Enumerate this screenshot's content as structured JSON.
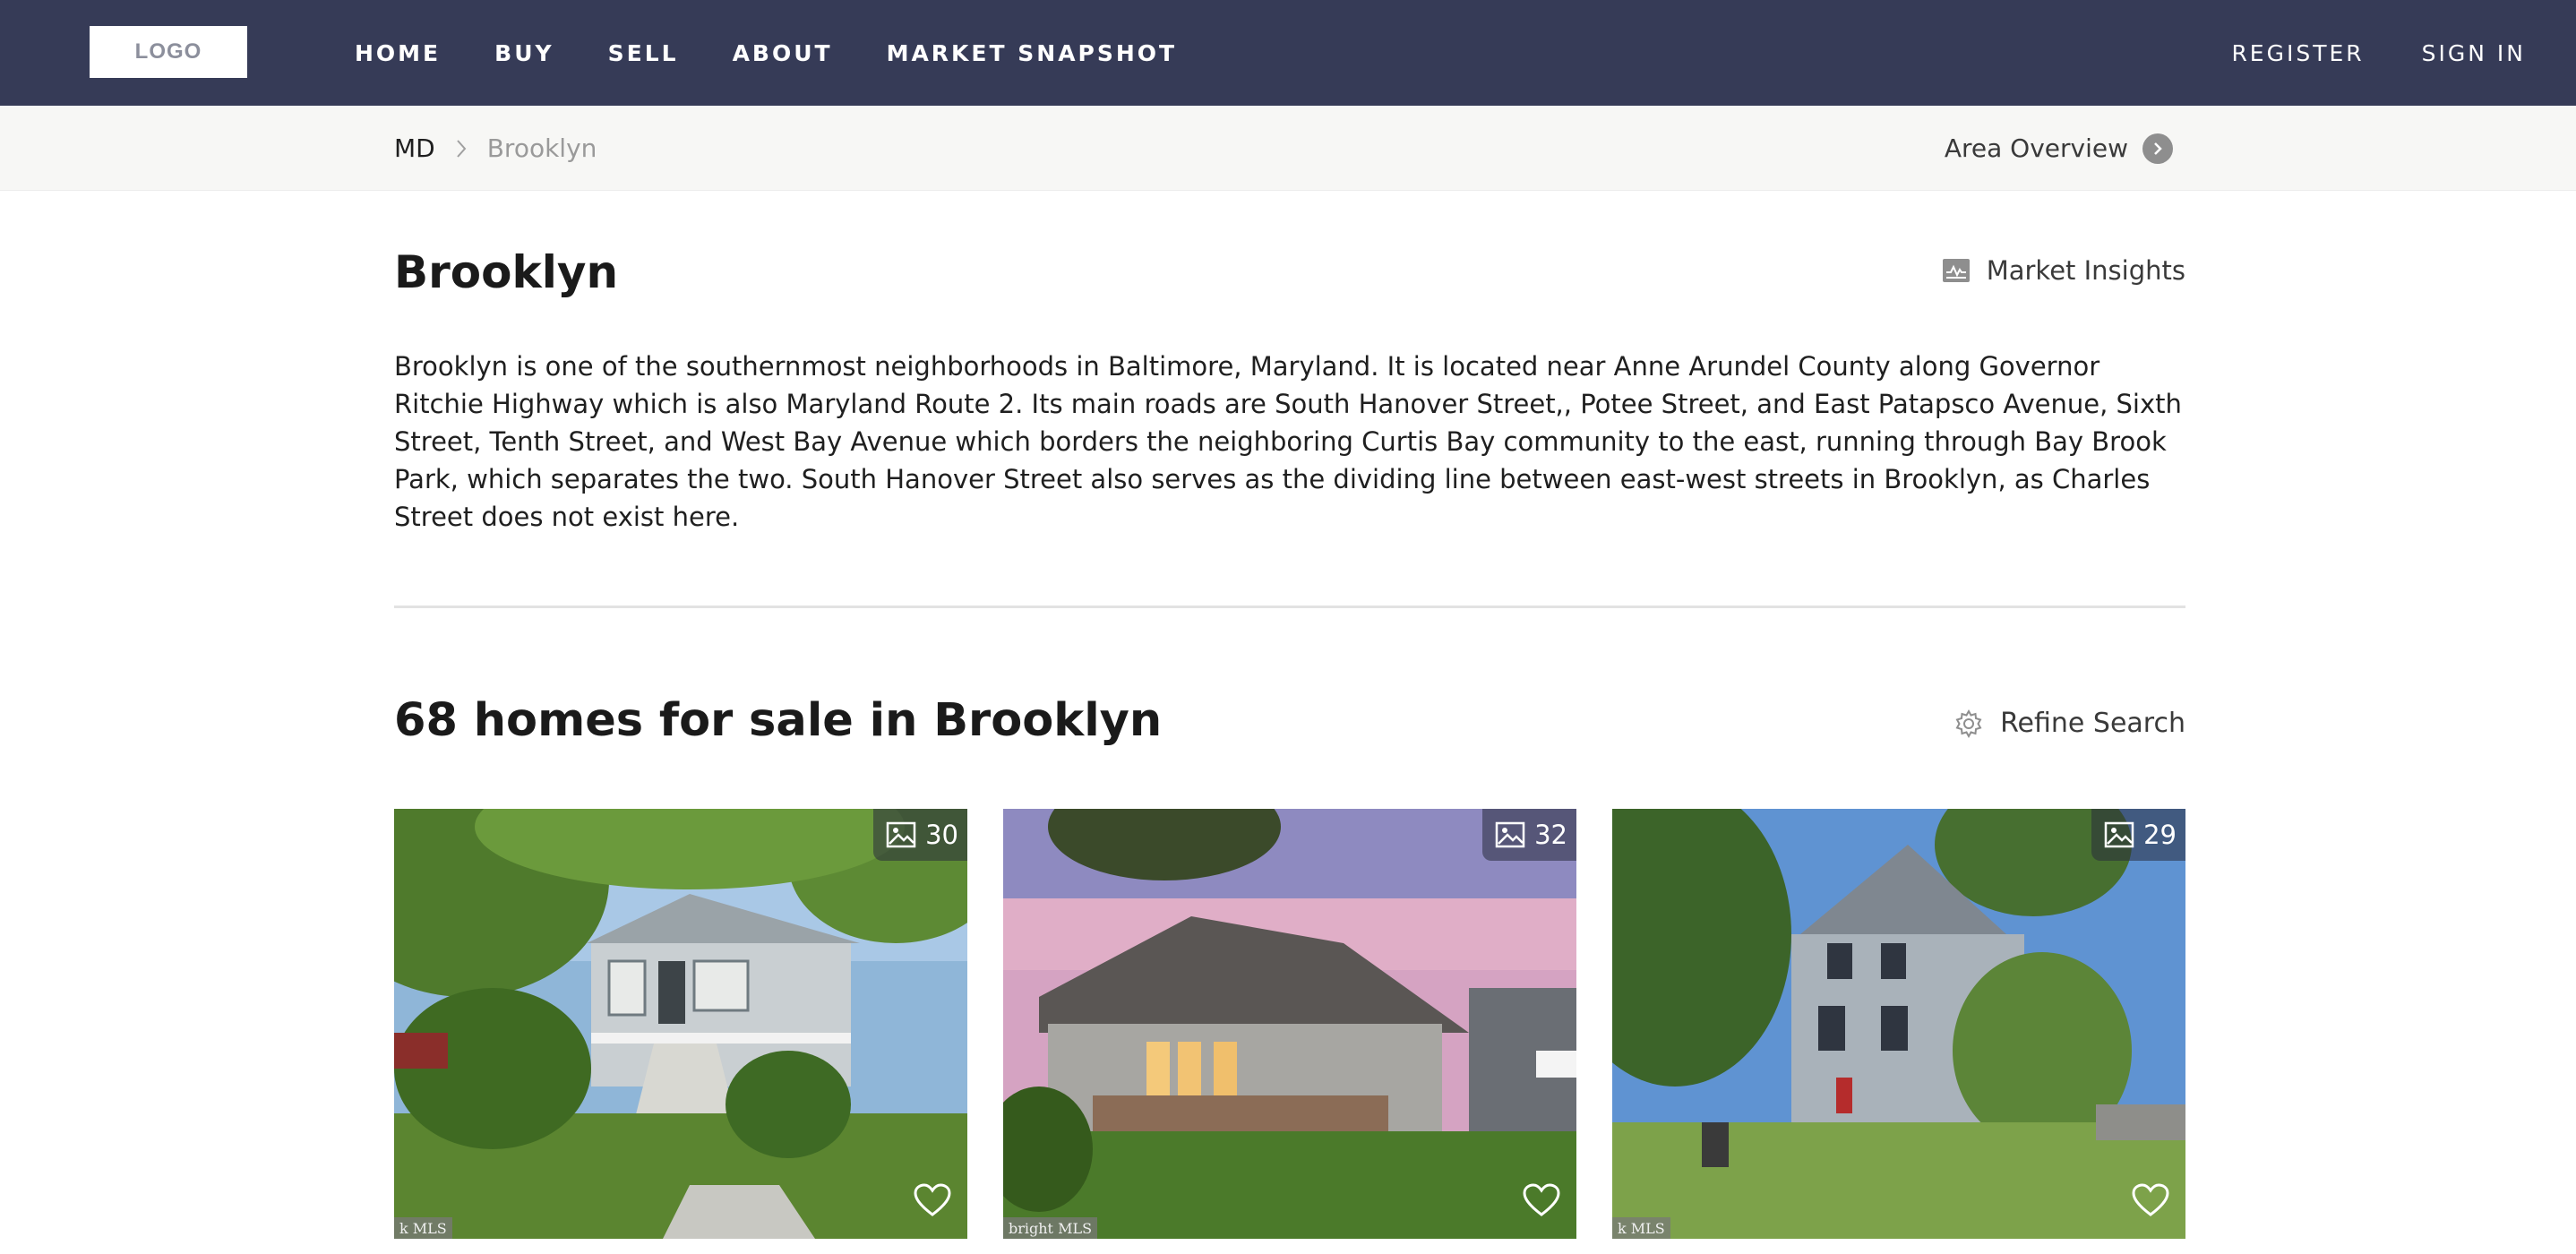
{
  "nav": {
    "logo": "LOGO",
    "links": [
      "HOME",
      "BUY",
      "SELL",
      "ABOUT",
      "MARKET SNAPSHOT"
    ],
    "right": [
      "REGISTER",
      "SIGN IN"
    ],
    "background": "#363b57"
  },
  "breadcrumb": {
    "items": [
      "MD",
      "Brooklyn"
    ],
    "area_overview": "Area Overview"
  },
  "main": {
    "title": "Brooklyn",
    "market_insights": "Market Insights",
    "description": "Brooklyn is one of the southernmost neighborhoods in Baltimore, Maryland. It is located near Anne Arundel County along Governor Ritchie Highway which is also Maryland Route 2. Its main roads are South Hanover Street,, Potee Street, and East Patapsco Avenue, Sixth Street, Tenth Street, and West Bay Avenue which borders the neighboring Curtis Bay community to the east, running through Bay Brook Park, which separates the two. South Hanover Street also serves as the dividing line between east-west streets in Brooklyn, as Charles Street does not exist here.",
    "listings_title": "68 homes for sale in Brooklyn",
    "refine_search": "Refine Search"
  },
  "listings": [
    {
      "photo_count": "30",
      "mls_label": "k MLS",
      "icon": "image-icon"
    },
    {
      "photo_count": "32",
      "mls_label": "bright MLS",
      "icon": "image-icon"
    },
    {
      "photo_count": "29",
      "mls_label": "k MLS",
      "icon": "image-icon"
    }
  ]
}
